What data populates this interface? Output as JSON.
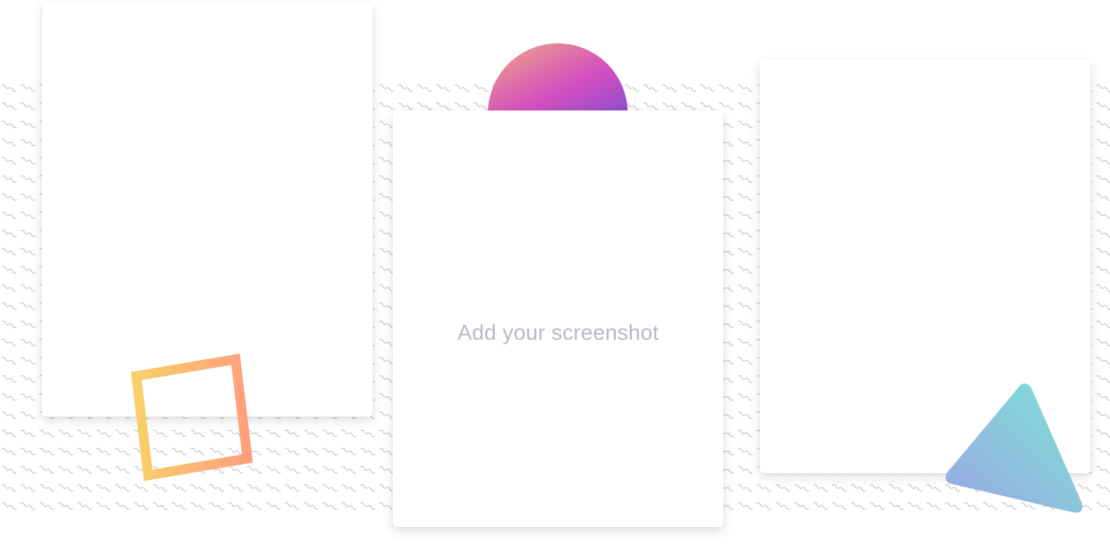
{
  "mockup": {
    "center_card": {
      "placeholder_text": "Add your screenshot"
    }
  },
  "decorations": {
    "semicircle": {
      "gradient": [
        "#f0a883",
        "#d44fbf",
        "#8c4fce"
      ]
    },
    "square_outline": {
      "gradient": [
        "#f8d06a",
        "#ff9f7c"
      ]
    },
    "triangle": {
      "gradient": [
        "#7de3d6",
        "#9aa6e3"
      ]
    },
    "pattern_color": "#cfcfcf"
  }
}
